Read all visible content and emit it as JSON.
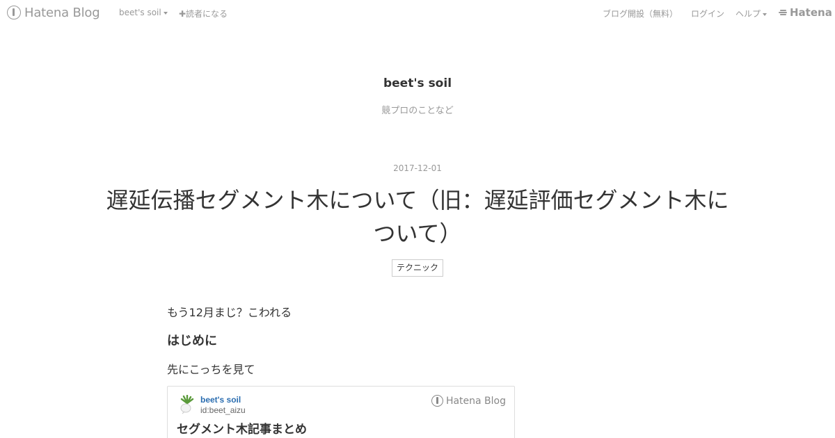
{
  "topbar": {
    "logo_text": "Hatena Blog",
    "blog_menu": "beet's soil",
    "subscribe": "✚読者になる",
    "signup": "ブログ開設（無料）",
    "login": "ログイン",
    "help": "ヘルプ",
    "hatena": "Hatena"
  },
  "blog": {
    "title": "beet's soil",
    "description": "競プロのことなど"
  },
  "entry": {
    "date": "2017-12-01",
    "title_line1": "遅延伝播セグメント木について（旧：遅延評価セグメント木に",
    "title_line2": "ついて）",
    "category": "テクニック",
    "paragraph1": "もう12月まじ？こわれる",
    "heading1": "はじめに",
    "paragraph2": "先にこっちを見て"
  },
  "embed_card": {
    "blog_name": "beet's soil",
    "user_id": "id:beet_aizu",
    "title": "セグメント木記事まとめ",
    "service_logo": "Hatena Blog"
  },
  "icons": {
    "hatena_blog_logo": "hatena-blog-icon",
    "hatena_logo": "hatena-icon",
    "beet_avatar": "beet-icon"
  },
  "colors": {
    "link_blue": "#2a6db0",
    "muted": "#999999",
    "text": "#333333"
  }
}
